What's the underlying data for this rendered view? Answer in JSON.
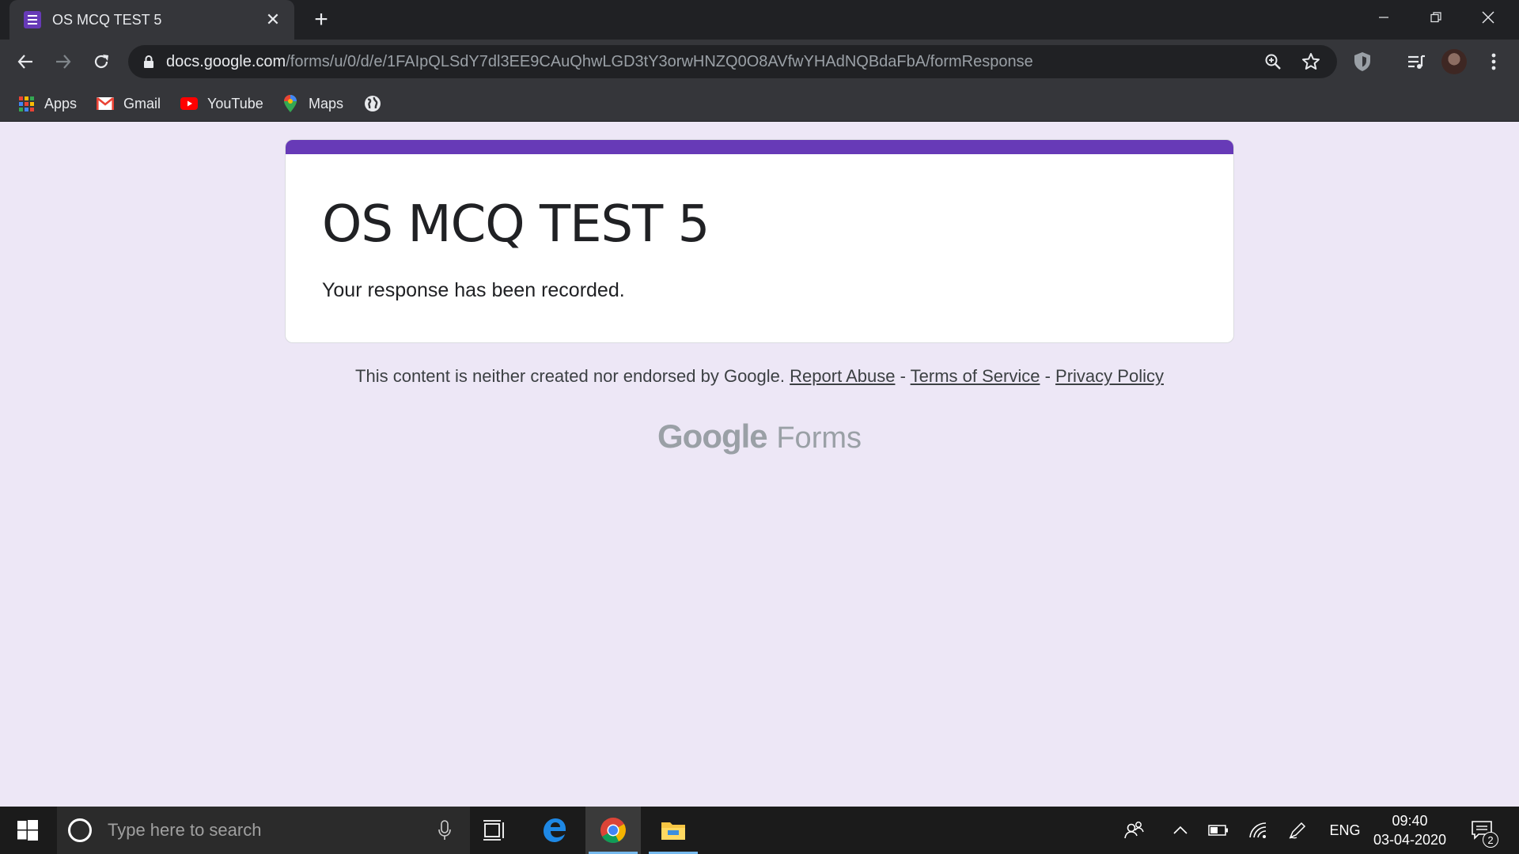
{
  "browser": {
    "tab": {
      "title": "OS MCQ TEST 5",
      "favicon": "google-forms-icon",
      "close": "✕"
    },
    "new_tab": "+",
    "address": {
      "host": "docs.google.com",
      "path": "/forms/u/0/d/e/1FAIpQLSdY7dl3EE9CAuQhwLGD3tY3orwHNZQ0O8AVfwYHAdNQBdaFbA/formResponse"
    },
    "bookmarks": [
      {
        "label": "Apps",
        "icon": "apps-grid-icon"
      },
      {
        "label": "Gmail",
        "icon": "gmail-icon"
      },
      {
        "label": "YouTube",
        "icon": "youtube-icon"
      },
      {
        "label": "Maps",
        "icon": "maps-icon"
      },
      {
        "label": "",
        "icon": "globe-icon"
      }
    ]
  },
  "form": {
    "title": "OS MCQ TEST 5",
    "message": "Your response has been recorded.",
    "accent_color": "#673ab7",
    "page_bg": "#ede7f6"
  },
  "footer": {
    "disclaimer": "This content is neither created nor endorsed by Google.",
    "report_abuse": "Report Abuse",
    "separator": "-",
    "terms": "Terms of Service",
    "privacy": "Privacy Policy",
    "logo_google": "Google",
    "logo_forms": "Forms"
  },
  "taskbar": {
    "search_placeholder": "Type here to search",
    "language": "ENG",
    "time": "09:40",
    "date": "03-04-2020",
    "notification_count": "2"
  }
}
